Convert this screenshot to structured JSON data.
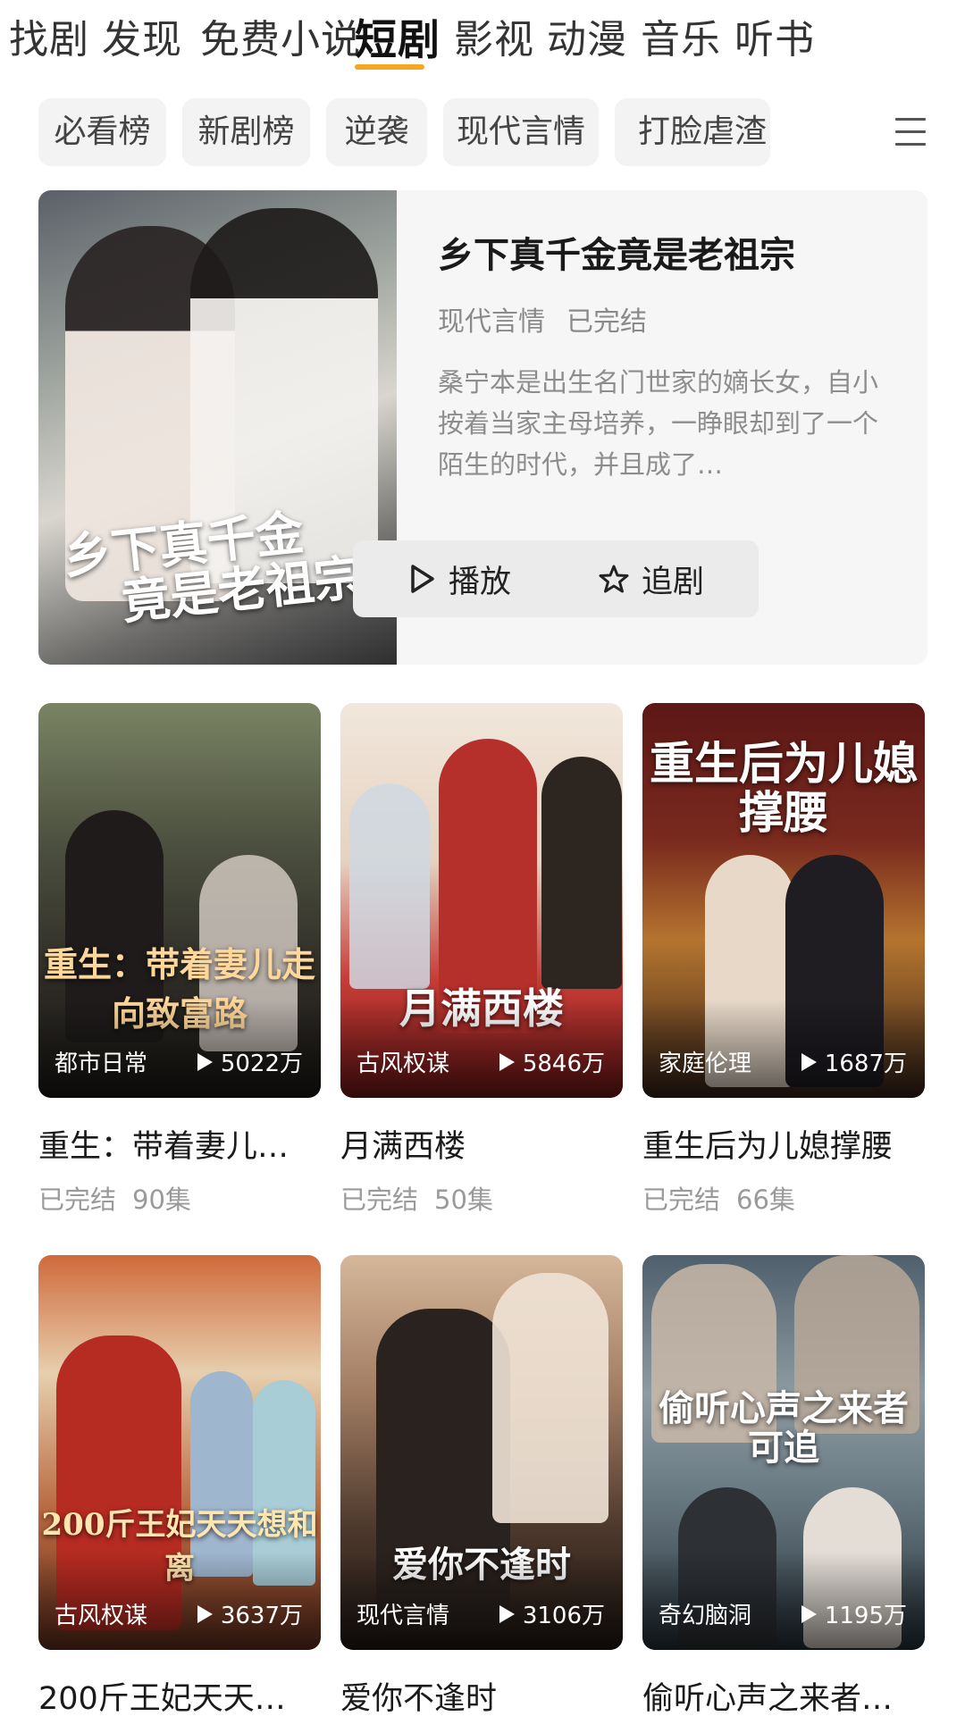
{
  "top_tabs": [
    "找剧",
    "发现",
    "免费小说",
    "短剧",
    "影视",
    "动漫",
    "音乐",
    "听书"
  ],
  "active_tab": "短剧",
  "chips": [
    "必看榜",
    "新剧榜",
    "逆袭",
    "现代言情",
    "打脸虐渣"
  ],
  "featured": {
    "title": "乡下真千金竟是老祖宗",
    "genre": "现代言情",
    "status": "已完结",
    "description": "桑宁本是出生名门世家的嫡长女，自小按着当家主母培养，一睁眼却到了一个陌生的时代，并且成了…",
    "poster_text": [
      "乡下真千金",
      "竟是老祖宗"
    ],
    "play_label": "播放",
    "follow_label": "追剧"
  },
  "dramas": [
    {
      "title": "重生：带着妻儿…",
      "poster_text": "重生：带着妻儿走向致富路",
      "genre": "都市日常",
      "views": "5022万",
      "status": "已完结",
      "episodes": "90集",
      "colors": [
        "#5f6a4e",
        "#3b3a33",
        "#23201c"
      ]
    },
    {
      "title": "月满西楼",
      "poster_text": "月满西楼",
      "genre": "古风权谋",
      "views": "5846万",
      "status": "已完结",
      "episodes": "50集",
      "colors": [
        "#efe3d7",
        "#c9403c",
        "#8e1d1d"
      ]
    },
    {
      "title": "重生后为儿媳撑腰",
      "poster_text": "重生后为儿媳撑腰",
      "genre": "家庭伦理",
      "views": "1687万",
      "status": "已完结",
      "episodes": "66集",
      "colors": [
        "#6e1c1a",
        "#b8692b",
        "#3a2419"
      ]
    },
    {
      "title": "200斤王妃天天…",
      "poster_text": "200斤王妃天天想和离",
      "genre": "古风权谋",
      "views": "3637万",
      "status": "",
      "episodes": "",
      "colors": [
        "#c55a31",
        "#e9d6b8",
        "#8a5036"
      ]
    },
    {
      "title": "爱你不逢时",
      "poster_text": "爱你不逢时",
      "genre": "现代言情",
      "views": "3106万",
      "status": "",
      "episodes": "",
      "colors": [
        "#c9a98a",
        "#6d4f3a",
        "#2b211b"
      ]
    },
    {
      "title": "偷听心声之来者…",
      "poster_text": "偷听心声之来者可追",
      "genre": "奇幻脑洞",
      "views": "1195万",
      "status": "",
      "episodes": "",
      "colors": [
        "#5d7180",
        "#8c9aa0",
        "#2c3a44"
      ]
    }
  ]
}
